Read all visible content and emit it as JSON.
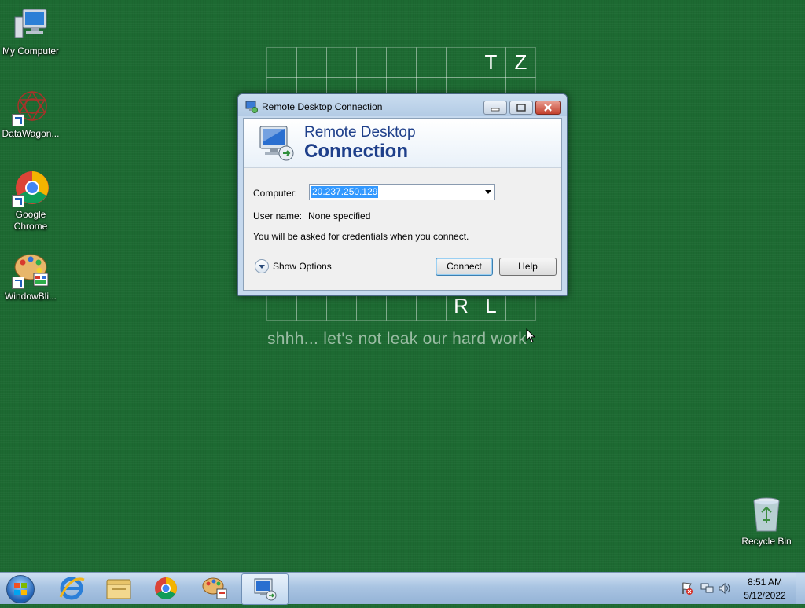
{
  "desktop": {
    "icons": [
      {
        "label": "My Computer"
      },
      {
        "label": "DataWagon..."
      },
      {
        "label": "Google Chrome"
      },
      {
        "label": "WindowBli..."
      }
    ],
    "recycle_bin": {
      "label": "Recycle Bin"
    },
    "wallpaper": {
      "letters_top": [
        "T",
        "Z"
      ],
      "letters_bottom": [
        "R",
        "L"
      ],
      "tagline": "shhh... let's not leak our hard work"
    }
  },
  "dialog": {
    "title": "Remote Desktop Connection",
    "banner_line1": "Remote Desktop",
    "banner_line2": "Connection",
    "computer_label": "Computer:",
    "computer_value": "20.237.250.129",
    "username_label": "User name:",
    "username_value": "None specified",
    "info_text": "You will be asked for credentials when you connect.",
    "show_options_label": "Show Options",
    "connect_label": "Connect",
    "help_label": "Help"
  },
  "taskbar": {
    "items": [
      "start-button",
      "internet-explorer-icon",
      "windows-explorer-icon",
      "chrome-icon",
      "windowblinds-icon",
      "remote-desktop-icon"
    ],
    "clock_time": "8:51 AM",
    "clock_date": "5/12/2022"
  }
}
